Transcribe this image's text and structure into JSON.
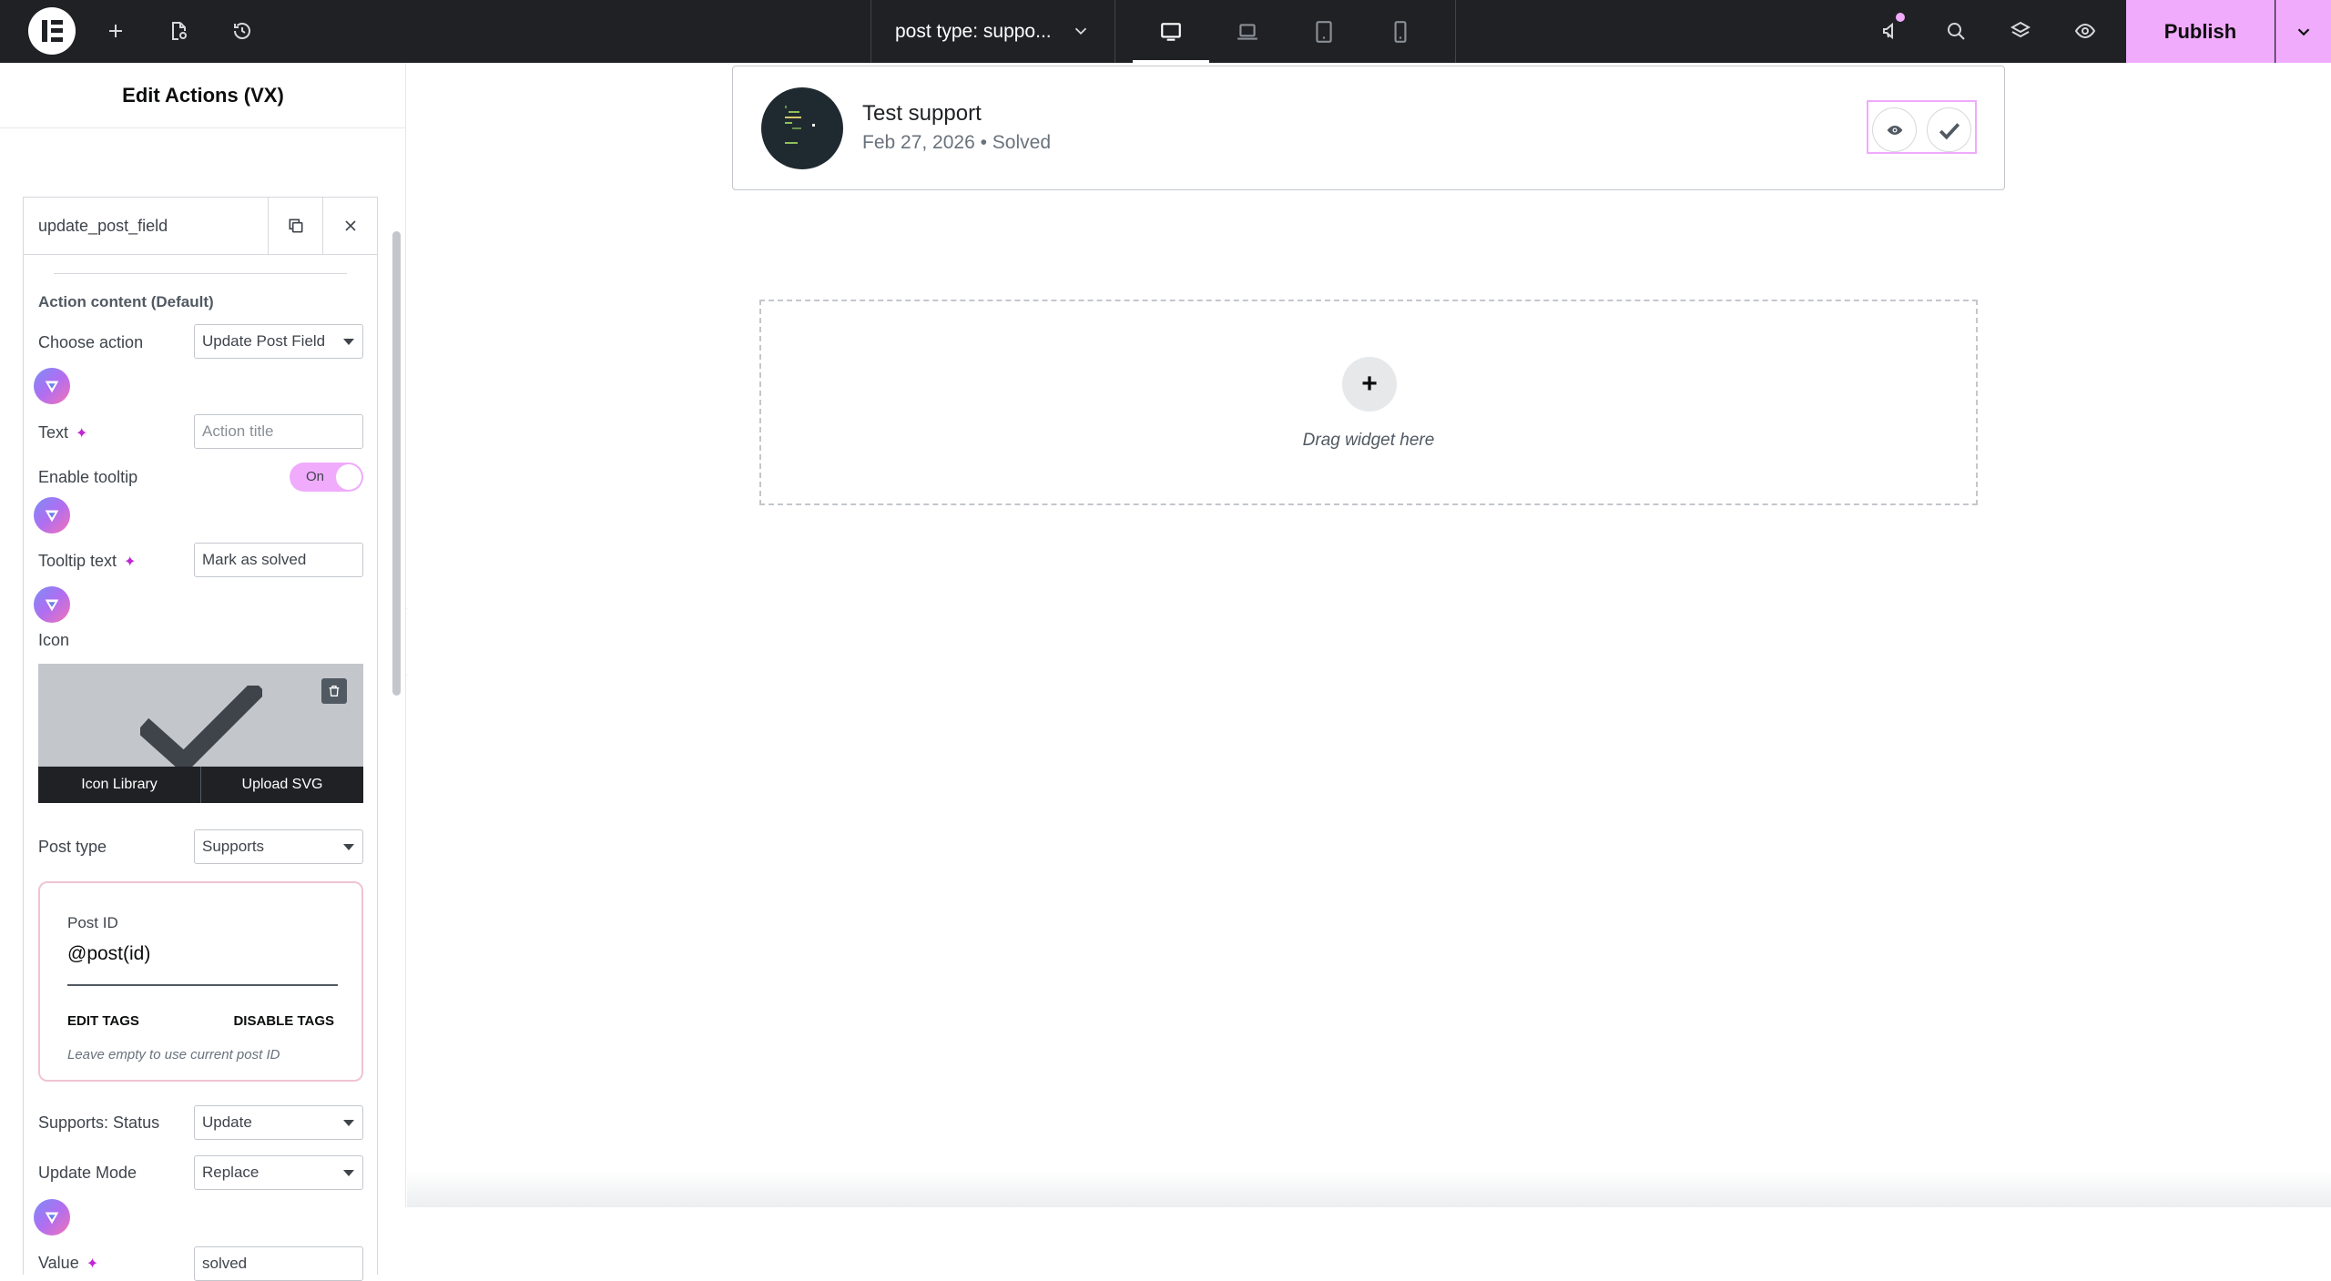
{
  "topbar": {
    "document_title": "post type: suppo...",
    "publish_label": "Publish",
    "icons": [
      "elementor-logo",
      "add-icon",
      "page-settings-icon",
      "history-icon",
      "chevron-down-icon",
      "desktop-icon",
      "laptop-icon",
      "tablet-icon",
      "mobile-icon",
      "whats-new-icon",
      "search-icon",
      "structure-icon",
      "preview-icon"
    ],
    "active_device": "desktop"
  },
  "panel": {
    "title": "Edit Actions (VX)",
    "repeater_item_title": "update_post_field",
    "section_title": "Action content (Default)",
    "choose_action": {
      "label": "Choose action",
      "value": "Update Post Field"
    },
    "text": {
      "label": "Text",
      "placeholder": "Action title"
    },
    "enable_tooltip": {
      "label": "Enable tooltip",
      "toggle": "On"
    },
    "tooltip_text": {
      "label": "Tooltip text",
      "value": "Mark as solved"
    },
    "icon": {
      "label": "Icon",
      "library_label": "Icon Library",
      "upload_label": "Upload SVG"
    },
    "post_type": {
      "label": "Post type",
      "value": "Supports"
    },
    "post_id": {
      "label": "Post ID",
      "value": "@post(id)",
      "edit_tags": "EDIT TAGS",
      "disable_tags": "DISABLE TAGS",
      "hint": "Leave empty to use current post ID"
    },
    "supports_status": {
      "label": "Supports: Status",
      "value": "Update"
    },
    "update_mode": {
      "label": "Update Mode",
      "value": "Replace"
    },
    "value_field": {
      "label": "Value",
      "value": "solved"
    }
  },
  "canvas": {
    "post": {
      "title": "Test support",
      "meta": "Feb 27, 2026 • Solved"
    },
    "drop_zone_text": "Drag widget here"
  },
  "colors": {
    "topbar_bg": "#1f2124",
    "accent_pink": "#f0abfc"
  }
}
